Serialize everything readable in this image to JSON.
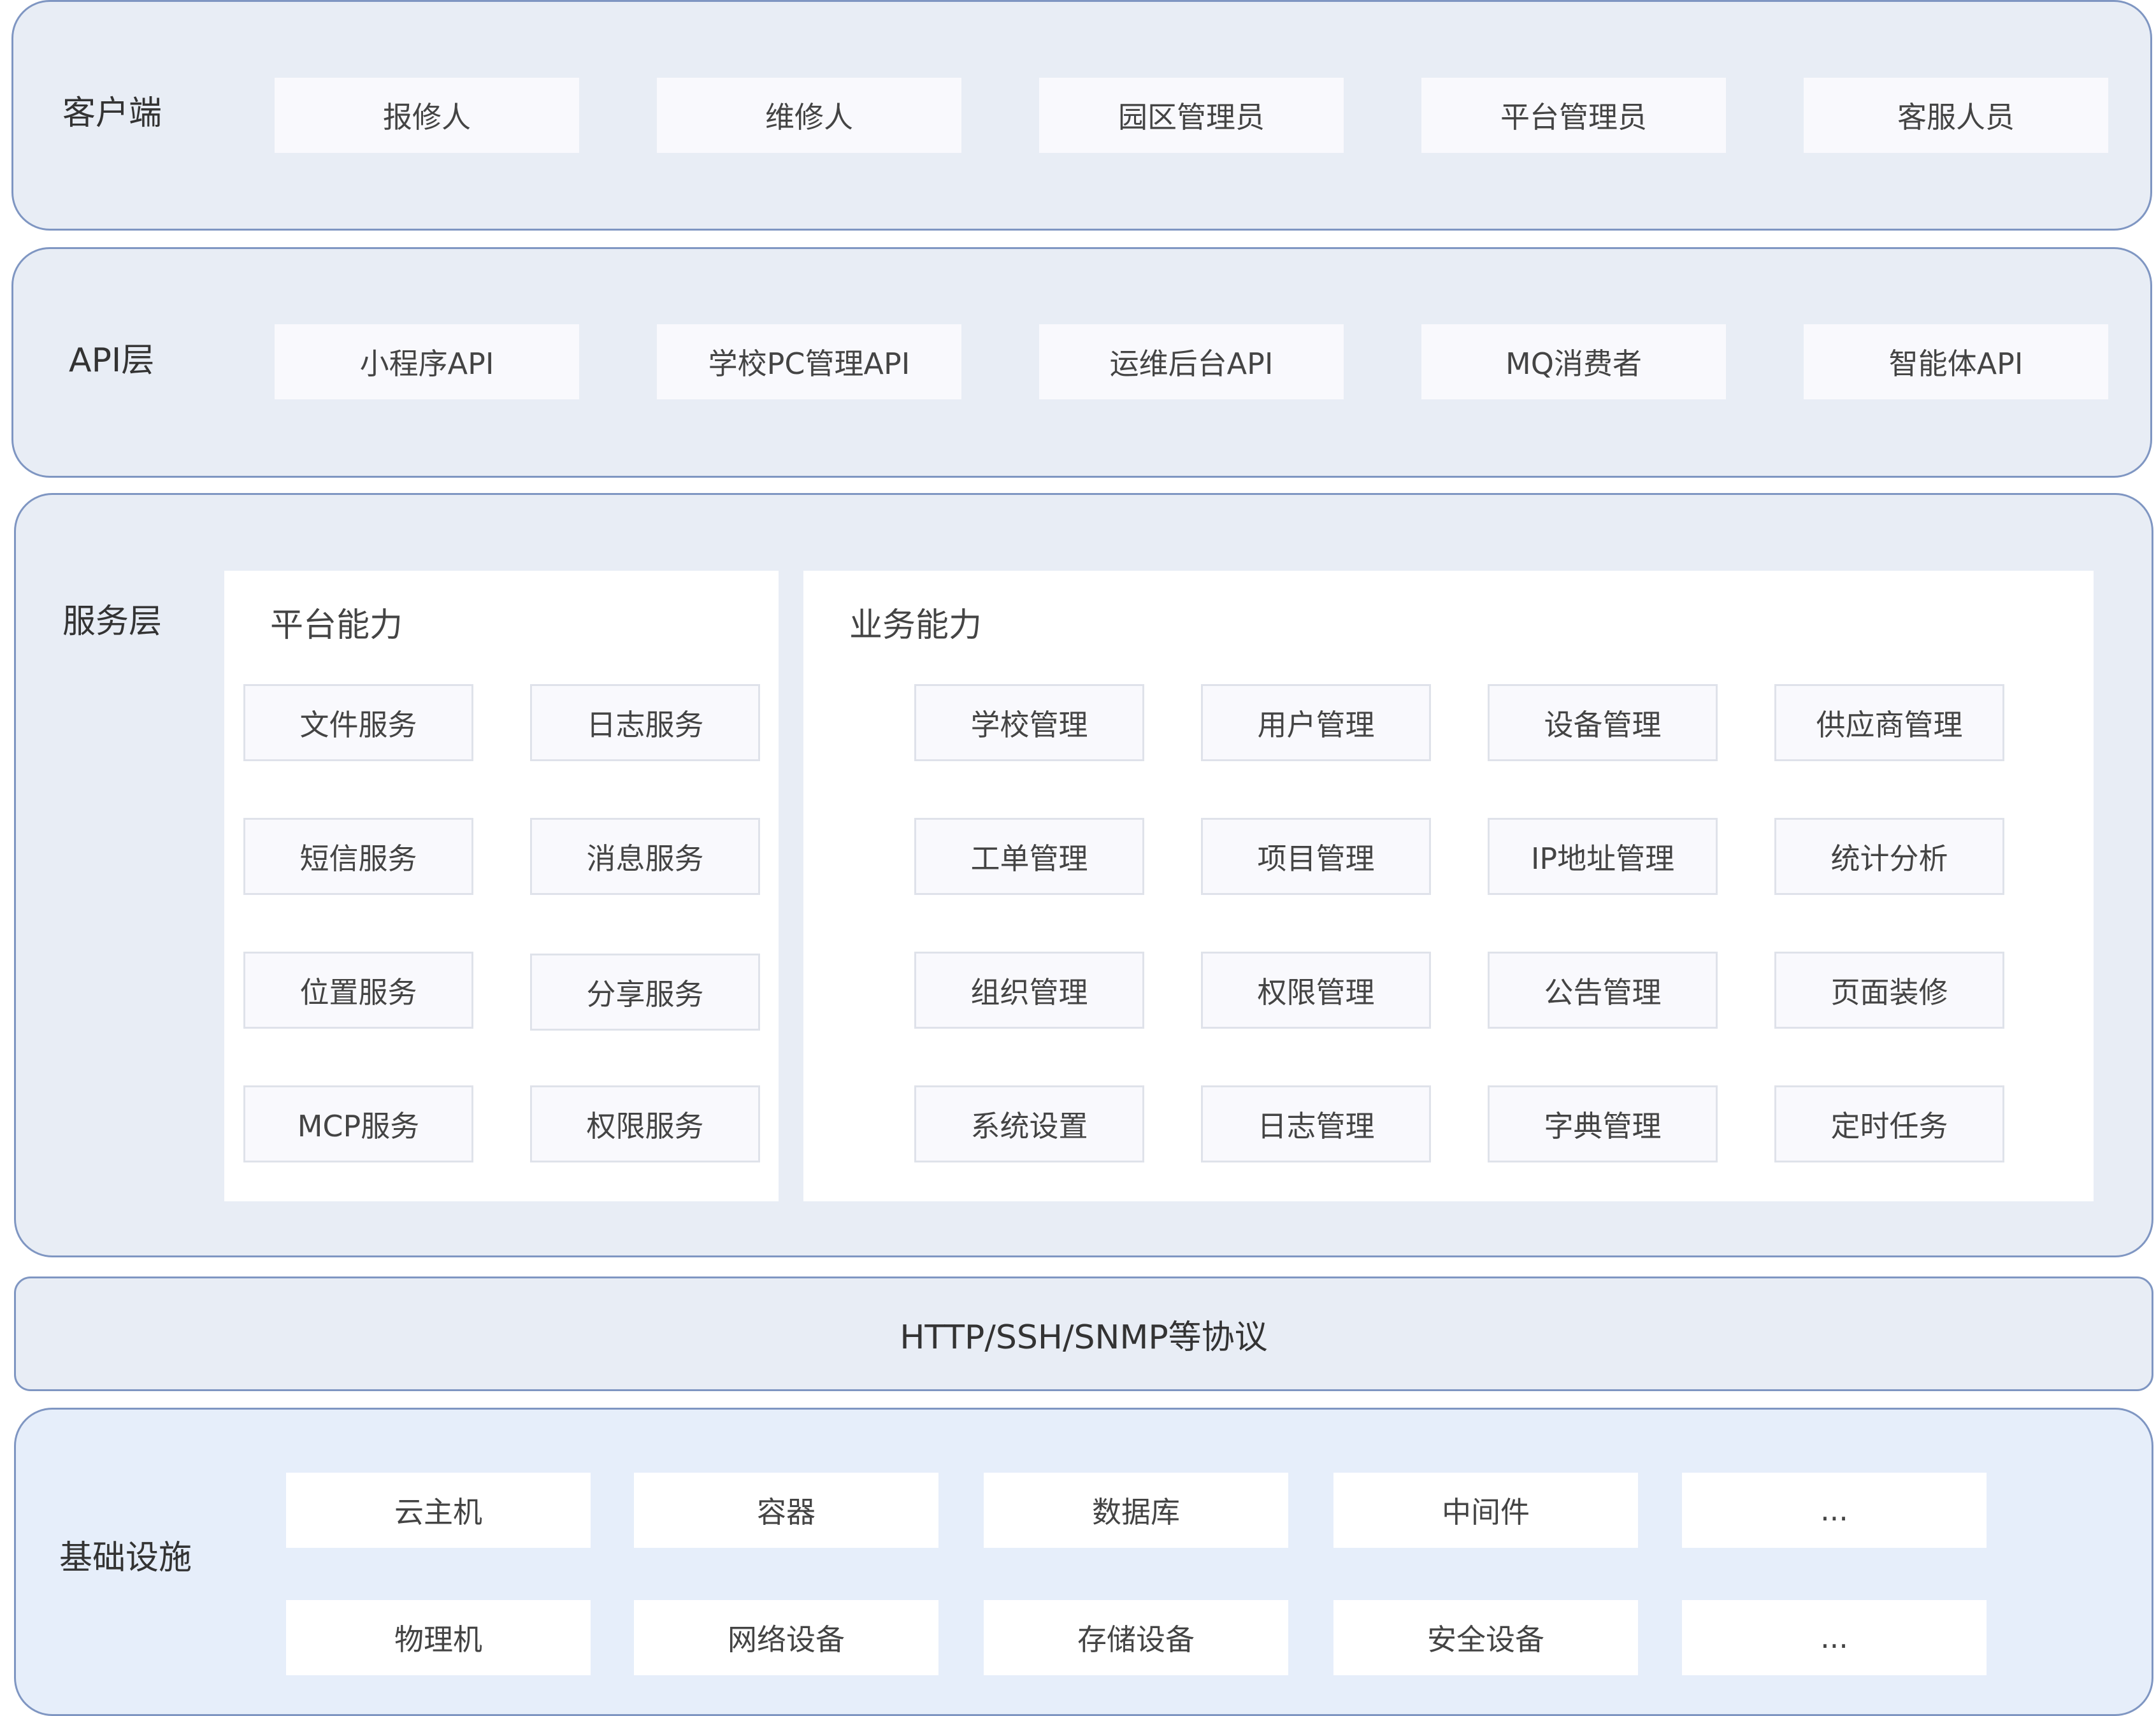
{
  "client": {
    "label": "客户端",
    "items": [
      "报修人",
      "维修人",
      "园区管理员",
      "平台管理员",
      "客服人员"
    ]
  },
  "api": {
    "label": "API层",
    "items": [
      "小程序API",
      "学校PC管理API",
      "运维后台API",
      "MQ消费者",
      "智能体API"
    ]
  },
  "service": {
    "label": "服务层",
    "platform": {
      "title": "平台能力",
      "items": [
        "文件服务",
        "日志服务",
        "短信服务",
        "消息服务",
        "位置服务",
        "分享服务",
        "MCP服务",
        "权限服务"
      ]
    },
    "business": {
      "title": "业务能力",
      "items": [
        "学校管理",
        "用户管理",
        "设备管理",
        "供应商管理",
        "工单管理",
        "项目管理",
        "IP地址管理",
        "统计分析",
        "组织管理",
        "权限管理",
        "公告管理",
        "页面装修",
        "系统设置",
        "日志管理",
        "字典管理",
        "定时任务"
      ]
    }
  },
  "protocol": {
    "label": "HTTP/SSH/SNMP等协议"
  },
  "infra": {
    "label": "基础设施",
    "row1": [
      "云主机",
      "容器",
      "数据库",
      "中间件",
      "..."
    ],
    "row2": [
      "物理机",
      "网络设备",
      "存储设备",
      "安全设备",
      "..."
    ]
  }
}
